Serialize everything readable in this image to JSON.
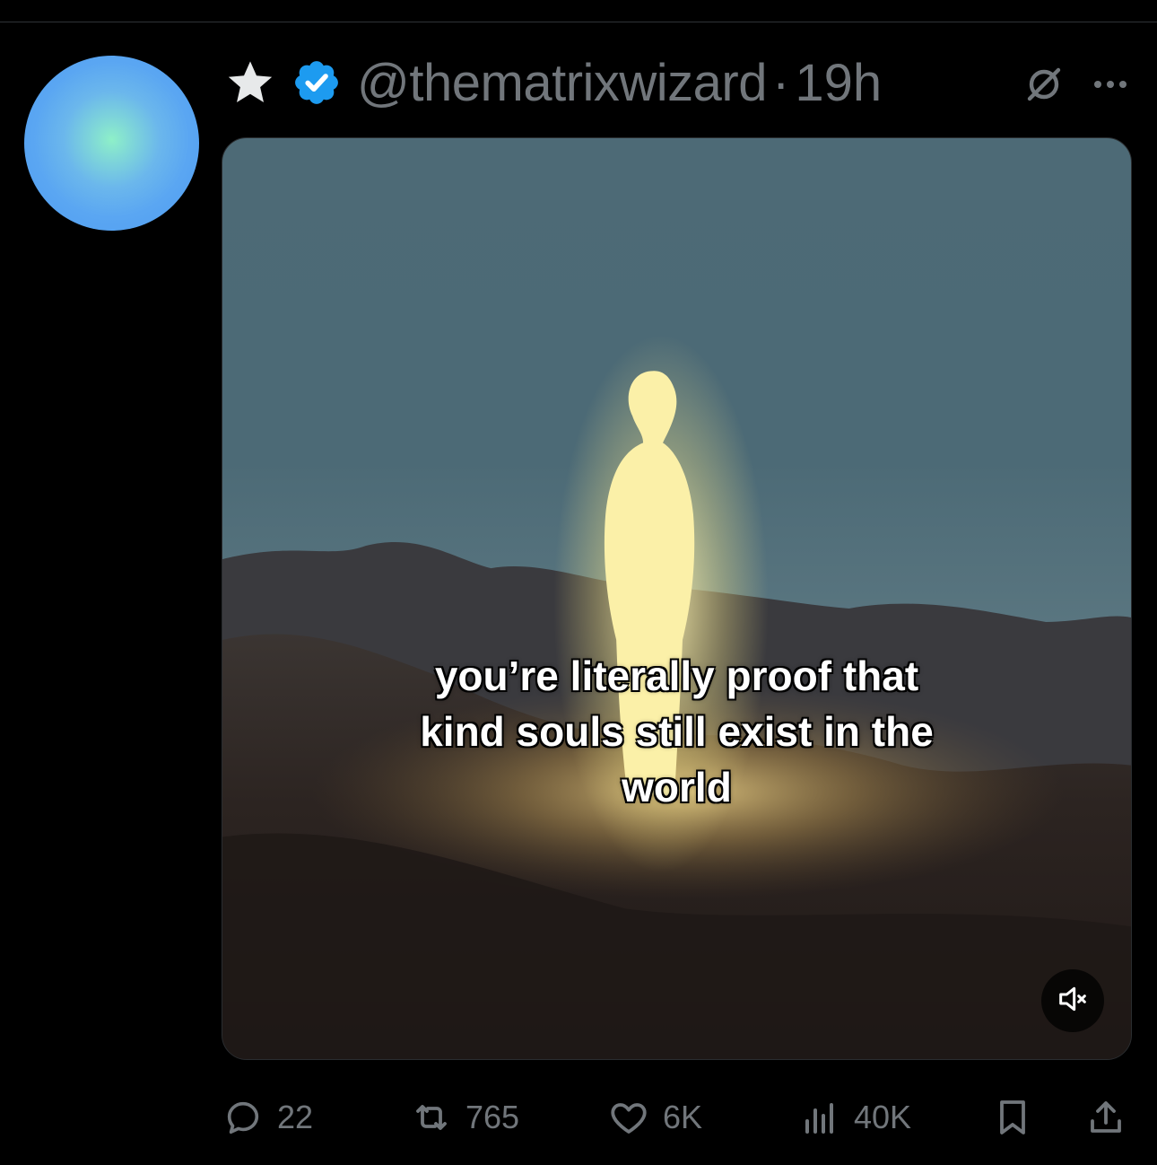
{
  "tweet": {
    "handle": "@thematrixwizard",
    "separator": "·",
    "time": "19h",
    "media": {
      "caption": "you’re literally proof that kind souls still exist in the world"
    },
    "stats": {
      "replies": "22",
      "reposts": "765",
      "likes": "6K",
      "views": "40K"
    }
  },
  "colors": {
    "background": "#000000",
    "muted_text": "#71767b",
    "verified_blue": "#1d9bf0"
  },
  "icons": [
    "star-icon",
    "verified-icon",
    "grok-icon",
    "more-icon",
    "mute-icon",
    "reply-icon",
    "repost-icon",
    "like-icon",
    "views-icon",
    "bookmark-icon",
    "share-icon"
  ]
}
